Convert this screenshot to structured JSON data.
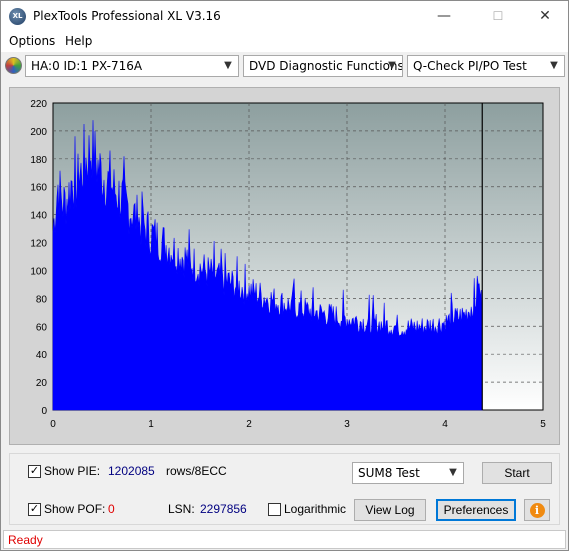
{
  "window": {
    "title": "PlexTools Professional XL V3.16",
    "app_icon_text": "XL",
    "minimize_glyph": "—",
    "maximize_glyph": "☐",
    "close_glyph": "✕"
  },
  "menu": {
    "items": [
      "Options",
      "Help"
    ]
  },
  "toolbar": {
    "drive": "HA:0 ID:1  PX-716A",
    "function": "DVD Diagnostic Functions",
    "test": "Q-Check PI/PO Test",
    "arrow": "▼"
  },
  "chart_data": {
    "type": "area",
    "x_ticks": [
      "0",
      "1",
      "2",
      "3",
      "4",
      "5"
    ],
    "y_ticks": [
      "0",
      "20",
      "40",
      "60",
      "80",
      "100",
      "120",
      "140",
      "160",
      "180",
      "200",
      "220"
    ],
    "xlim": [
      0,
      5
    ],
    "ylim": [
      0,
      220
    ],
    "grid": true,
    "marker_x": 4.38,
    "series": [
      {
        "color": "#0000ff",
        "x": [
          0,
          0.05,
          0.1,
          0.15,
          0.2,
          0.25,
          0.3,
          0.35,
          0.4,
          0.45,
          0.5,
          0.6,
          0.7,
          0.8,
          0.9,
          1.0,
          1.2,
          1.4,
          1.6,
          1.8,
          2.0,
          2.2,
          2.4,
          2.6,
          2.8,
          3.0,
          3.2,
          3.4,
          3.6,
          3.8,
          4.0,
          4.1,
          4.2,
          4.3,
          4.35,
          4.38
        ],
        "values": [
          135,
          170,
          155,
          160,
          175,
          168,
          182,
          190,
          198,
          185,
          178,
          168,
          160,
          150,
          140,
          133,
          122,
          112,
          103,
          96,
          90,
          84,
          79,
          75,
          72,
          69,
          66,
          64,
          62,
          63,
          66,
          69,
          72,
          80,
          92,
          78
        ]
      }
    ]
  },
  "controls": {
    "show_pie_label": "Show PIE:",
    "pie_value": "1202085",
    "rows_unit": "rows/8ECC",
    "show_pof_label": "Show POF:",
    "pof_value": "0",
    "lsn_label": "LSN:",
    "lsn_value": "2297856",
    "logarithmic_label": "Logarithmic",
    "sum_select": "SUM8 Test",
    "start_button": "Start",
    "view_log_button": "View Log",
    "preferences_button": "Preferences",
    "info_glyph": "i",
    "check_glyph": "✓",
    "accent_blue": "#000080",
    "accent_red": "#e00000"
  },
  "status": {
    "text": "Ready"
  }
}
